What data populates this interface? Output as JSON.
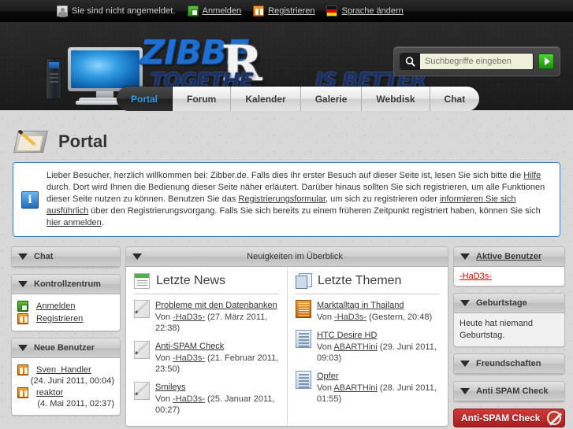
{
  "topbar": {
    "status_text": "Sie sind nicht angemeldet.",
    "login_label": "Anmelden",
    "register_label": "Registrieren",
    "language_label": "Sprache ändern"
  },
  "logo": {
    "name_main": "ZIBBE",
    "name_r": "R",
    "tagline_1": "TOGETHE",
    "tagline_2": "IS BETTER"
  },
  "search": {
    "placeholder": "Suchbegriffe eingeben",
    "value": "",
    "submit_label": "►"
  },
  "nav": {
    "tabs": [
      {
        "label": "Portal",
        "active": true
      },
      {
        "label": "Forum",
        "active": false
      },
      {
        "label": "Kalender",
        "active": false
      },
      {
        "label": "Galerie",
        "active": false
      },
      {
        "label": "Webdisk",
        "active": false
      },
      {
        "label": "Chat",
        "active": false
      }
    ]
  },
  "page": {
    "title": "Portal"
  },
  "infobox": {
    "part1": "Lieber Besucher, herzlich willkommen bei: Zibber.de. Falls dies Ihr erster Besuch auf dieser Seite ist, lesen Sie sich bitte die ",
    "link_help": "Hilfe",
    "part2": " durch. Dort wird Ihnen die Bedienung dieser Seite näher erläutert. Darüber hinaus sollten Sie sich registrieren, um alle Funktionen dieser Seite nutzen zu können. Benutzen Sie das ",
    "link_regform": "Registrierungsformular",
    "part3": ", um sich zu registrieren oder ",
    "link_info": "informieren Sie sich ausführlich",
    "part4": " über den Registrierungsvorgang. Falls Sie sich bereits zu einem früheren Zeitpunkt registriert haben, können Sie sich ",
    "link_login": "hier anmelden",
    "part5": "."
  },
  "left": {
    "chat": {
      "title": "Chat"
    },
    "control": {
      "title": "Kontrollzentrum",
      "items": [
        {
          "label": "Anmelden",
          "icon": "login-icon"
        },
        {
          "label": "Registrieren",
          "icon": "register-icon"
        }
      ]
    },
    "new_users": {
      "title": "Neue Benutzer",
      "items": [
        {
          "name": "Sven_Handler",
          "date": "(24. Juni 2011, 00:04)"
        },
        {
          "name": "reaktor",
          "date": "(4. Mai 2011, 02:37)"
        }
      ]
    }
  },
  "center": {
    "panel_title": "Neuigkeiten im Überblick",
    "news": {
      "heading": "Letzte News",
      "items": [
        {
          "title": "Probleme mit den Datenbanken",
          "von": "Von ",
          "author": "-HaD3s-",
          "date": " (27. März 2011, 22:38)"
        },
        {
          "title": "Anti-SPAM Check",
          "von": "Von ",
          "author": "-HaD3s-",
          "date": " (21. Februar 2011, 23:50)"
        },
        {
          "title": "Smileys",
          "von": "Von ",
          "author": "-HaD3s-",
          "date": " (25. Januar 2011, 00:27)"
        }
      ]
    },
    "threads": {
      "heading": "Letzte Themen",
      "items": [
        {
          "title": "Marktalltag in Thailand",
          "von": "Von ",
          "author": "-HaD3s-",
          "date": " (Gestern, 20:48)"
        },
        {
          "title": "HTC Desire HD",
          "von": "Von ",
          "author": "ABARTHini",
          "date": " (29. Juni 2011, 09:03)"
        },
        {
          "title": "Opfer",
          "von": "Von ",
          "author": "ABARTHini",
          "date": " (28. Juni 2011, 01:55)"
        }
      ]
    }
  },
  "right": {
    "active_users": {
      "title": "Aktive Benutzer",
      "users": [
        "-HaD3s-"
      ]
    },
    "birthdays": {
      "title": "Geburtstage",
      "text": "Heute hat niemand Geburtstag."
    },
    "friendships": {
      "title": "Freundschaften"
    },
    "antispam": {
      "title": "Anti SPAM Check",
      "banner_label": "Anti-SPAM Check"
    }
  },
  "colors": {
    "accent_blue": "#2e9be8",
    "link_red": "#e00000",
    "info_border": "#2d7fd0",
    "spam_red": "#a61f1f"
  }
}
